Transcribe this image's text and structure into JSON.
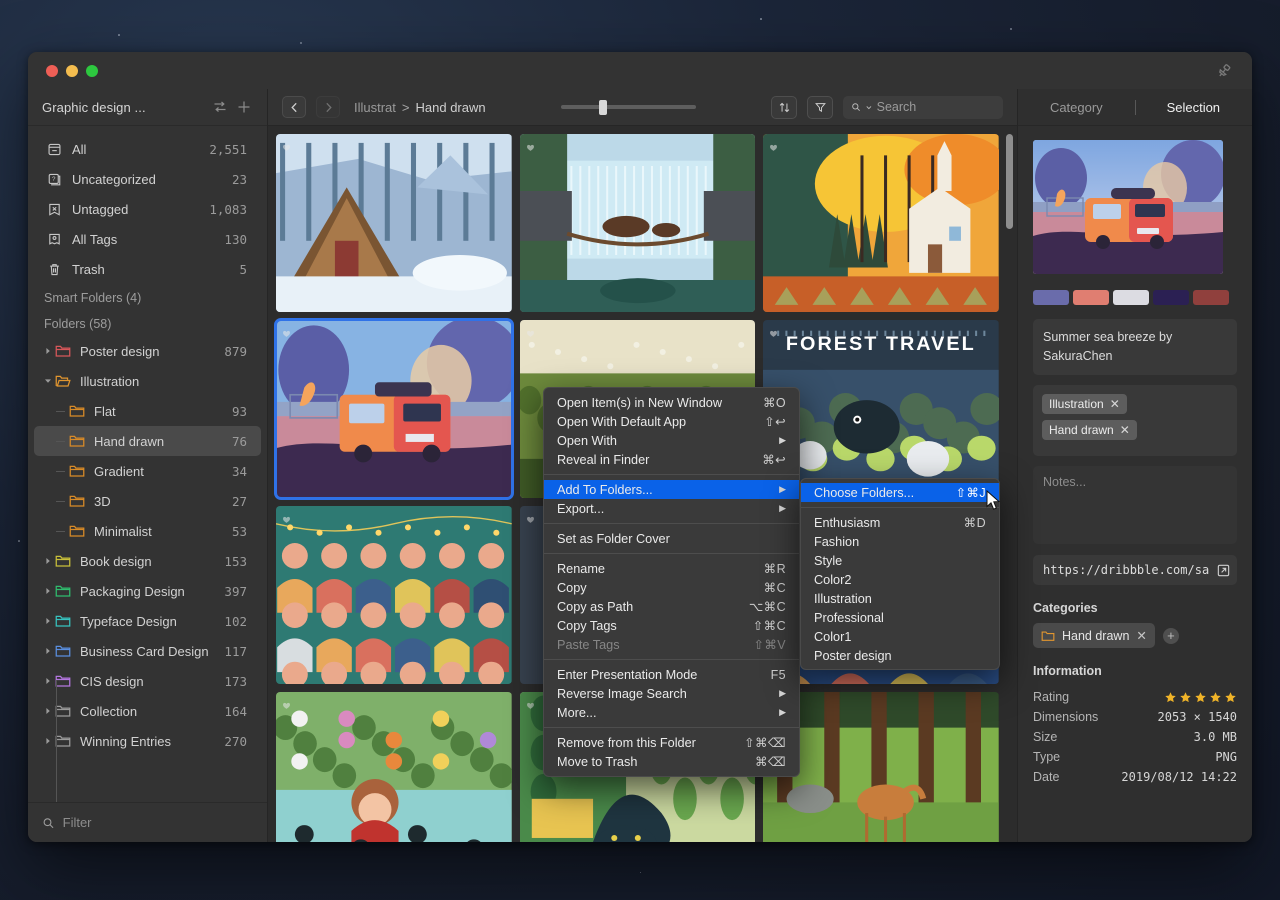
{
  "window": {
    "traffic_lights": [
      "close",
      "minimize",
      "maximize"
    ],
    "pin_icon": "pin-icon"
  },
  "sidebar": {
    "title": "Graphic design ...",
    "sort_icon": "sort-icon",
    "add_icon": "plus-icon",
    "library": [
      {
        "icon": "all-icon",
        "label": "All",
        "count": "2,551"
      },
      {
        "icon": "uncategorized-icon",
        "label": "Uncategorized",
        "count": "23"
      },
      {
        "icon": "untagged-icon",
        "label": "Untagged",
        "count": "1,083"
      },
      {
        "icon": "all-tags-icon",
        "label": "All Tags",
        "count": "130"
      },
      {
        "icon": "trash-icon",
        "label": "Trash",
        "count": "5"
      }
    ],
    "smart_folders_header": "Smart Folders (4)",
    "folders_header": "Folders (58)",
    "folders": [
      {
        "label": "Poster design",
        "count": "879",
        "color": "#d8575a",
        "expanded": false,
        "child": false
      },
      {
        "label": "Illustration",
        "count": "",
        "color": "#e2962f",
        "expanded": true,
        "child": false
      },
      {
        "label": "Flat",
        "count": "93",
        "color": "#d98b27",
        "child": true
      },
      {
        "label": "Hand drawn",
        "count": "76",
        "color": "#d98b27",
        "child": true,
        "selected": true
      },
      {
        "label": "Gradient",
        "count": "34",
        "color": "#d98b27",
        "child": true
      },
      {
        "label": "3D",
        "count": "27",
        "color": "#d98b27",
        "child": true
      },
      {
        "label": "Minimalist",
        "count": "53",
        "color": "#d98b27",
        "child": true
      },
      {
        "label": "Book design",
        "count": "153",
        "color": "#c9c03a",
        "expanded": false,
        "child": false
      },
      {
        "label": "Packaging Design",
        "count": "397",
        "color": "#2fbd6e",
        "expanded": false,
        "child": false
      },
      {
        "label": "Typeface Design",
        "count": "102",
        "color": "#37c4c0",
        "expanded": false,
        "child": false
      },
      {
        "label": "Business Card Design",
        "count": "117",
        "color": "#5a8fe0",
        "expanded": false,
        "child": false
      },
      {
        "label": "CIS design",
        "count": "173",
        "color": "#b477e0",
        "expanded": false,
        "child": false
      },
      {
        "label": "Collection",
        "count": "164",
        "color": "#9a9a9a",
        "expanded": false,
        "child": false
      },
      {
        "label": "Winning Entries",
        "count": "270",
        "color": "#9a9a9a",
        "expanded": false,
        "child": false
      }
    ],
    "filter_placeholder": "Filter",
    "filter_value": ""
  },
  "toolbar": {
    "back_icon": "chevron-left-icon",
    "forward_icon": "chevron-right-icon",
    "breadcrumb_parent": "Illustrat",
    "breadcrumb_separator": ">",
    "breadcrumb_current": "Hand drawn",
    "zoom_slider_percent": 28,
    "sort_icon": "sort-arrows-icon",
    "filter_icon": "funnel-icon",
    "search_icon": "search-icon",
    "search_placeholder": "Search",
    "search_value": ""
  },
  "grid": {
    "items": [
      {
        "name": "snow-cabin-illustration",
        "selected": false
      },
      {
        "name": "waterfall-bears-illustration",
        "selected": false
      },
      {
        "name": "autumn-church-illustration",
        "selected": false
      },
      {
        "name": "summer-sea-breeze-van-illustration",
        "selected": true
      },
      {
        "name": "meadow-illustration",
        "selected": false
      },
      {
        "name": "forest-travel-poster",
        "selected": false
      },
      {
        "name": "crowd-people-illustration",
        "selected": false
      },
      {
        "name": "hidden-illustration",
        "selected": false
      },
      {
        "name": "market-people-illustration",
        "selected": false
      },
      {
        "name": "girl-in-flowers-illustration",
        "selected": false
      },
      {
        "name": "cat-in-garden-illustration",
        "selected": false
      },
      {
        "name": "deer-in-forest-illustration",
        "selected": false
      }
    ]
  },
  "context_menu": {
    "groups": [
      [
        {
          "label": "Open Item(s) in New Window",
          "key": "⌘O"
        },
        {
          "label": "Open With Default App",
          "key": "⇧↩"
        },
        {
          "label": "Open With",
          "submenu": true
        },
        {
          "label": "Reveal in Finder",
          "key": "⌘↩"
        }
      ],
      [
        {
          "label": "Add To Folders...",
          "submenu": true,
          "highlighted": true
        },
        {
          "label": "Export...",
          "submenu": true
        }
      ],
      [
        {
          "label": "Set as Folder Cover"
        }
      ],
      [
        {
          "label": "Rename",
          "key": "⌘R"
        },
        {
          "label": "Copy",
          "key": "⌘C"
        },
        {
          "label": "Copy as Path",
          "key": "⌥⌘C"
        },
        {
          "label": "Copy Tags",
          "key": "⇧⌘C"
        },
        {
          "label": "Paste Tags",
          "key": "⇧⌘V",
          "disabled": true
        }
      ],
      [
        {
          "label": "Enter Presentation Mode",
          "key": "F5"
        },
        {
          "label": "Reverse Image Search",
          "submenu": true
        },
        {
          "label": "More...",
          "submenu": true
        }
      ],
      [
        {
          "label": "Remove from this Folder",
          "key": "⇧⌘⌫"
        },
        {
          "label": "Move to Trash",
          "key": "⌘⌫"
        }
      ]
    ]
  },
  "submenu": {
    "groups": [
      [
        {
          "label": "Choose Folders...",
          "key": "⇧⌘J",
          "highlighted": true
        }
      ],
      [
        {
          "label": "Enthusiasm",
          "key": "⌘D"
        },
        {
          "label": "Fashion"
        },
        {
          "label": "Style"
        },
        {
          "label": "Color2"
        },
        {
          "label": "Illustration"
        },
        {
          "label": "Professional"
        },
        {
          "label": "Color1"
        },
        {
          "label": "Poster design"
        }
      ]
    ]
  },
  "inspector": {
    "tabs": [
      {
        "label": "Category",
        "active": false
      },
      {
        "label": "Selection",
        "active": true
      }
    ],
    "preview_name": "summer-sea-breeze-preview",
    "swatches": [
      "#6a6cab",
      "#e07e71",
      "#dcdce2",
      "#2b2053",
      "#90403d"
    ],
    "title": "Summer sea breeze by SakuraChen",
    "tags": [
      "Illustration",
      "Hand drawn"
    ],
    "notes_placeholder": "Notes...",
    "notes_value": "",
    "url": "https://dribbble.com/sa",
    "open_link_icon": "external-link-icon",
    "categories_header": "Categories",
    "categories": [
      "Hand drawn"
    ],
    "add_category_icon": "plus-circle-icon",
    "information_header": "Information",
    "information": [
      {
        "key": "Rating",
        "value": "",
        "stars": 5
      },
      {
        "key": "Dimensions",
        "value": "2053 × 1540"
      },
      {
        "key": "Size",
        "value": "3.0 MB"
      },
      {
        "key": "Type",
        "value": "PNG"
      },
      {
        "key": "Date",
        "value": "2019/08/12 14:22"
      }
    ]
  },
  "colors": {
    "accent": "#0a62e8",
    "selection_outline": "#2f72e8",
    "star": "#f0b429",
    "window_bg": "#2d2d2d",
    "sidebar_bg": "#333333",
    "menu_bg": "#3a3a3a"
  }
}
